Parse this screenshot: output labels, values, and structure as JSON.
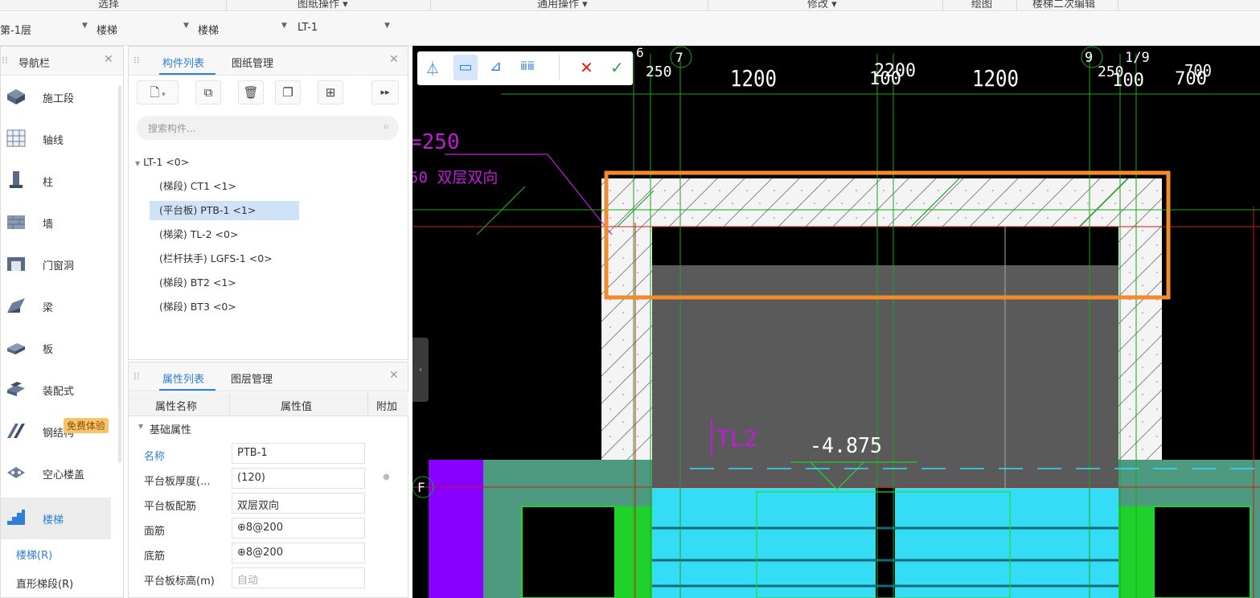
{
  "ribbon": {
    "groups": [
      "选择",
      "图纸操作 ▾",
      "通用操作 ▾",
      "修改 ▾",
      "绘图",
      "楼梯二次编辑"
    ]
  },
  "toolbar2": {
    "dropdowns": [
      "第-1层",
      "楼梯",
      "楼梯",
      "LT-1"
    ]
  },
  "nav": {
    "title": "导航栏",
    "items": [
      {
        "label": "施工段",
        "icon": "construction-segment-icon"
      },
      {
        "label": "轴线",
        "icon": "grid-axis-icon"
      },
      {
        "label": "柱",
        "icon": "column-icon"
      },
      {
        "label": "墙",
        "icon": "wall-icon"
      },
      {
        "label": "门窗洞",
        "icon": "door-window-icon"
      },
      {
        "label": "梁",
        "icon": "beam-icon"
      },
      {
        "label": "板",
        "icon": "slab-icon"
      },
      {
        "label": "装配式",
        "icon": "prefab-icon"
      },
      {
        "label": "钢结构",
        "icon": "steel-icon"
      },
      {
        "label": "空心楼盖",
        "icon": "hollow-floor-icon"
      },
      {
        "label": "楼梯",
        "icon": "stair-icon"
      }
    ],
    "badge": "免费体验",
    "sub_items": [
      "楼梯(R)",
      "直形梯段(R)"
    ]
  },
  "components": {
    "tabs": [
      "构件列表",
      "图纸管理"
    ],
    "search_placeholder": "搜索构件...",
    "tree_root": "LT-1 <0>",
    "tree_items": [
      "(梯段) CT1 <1>",
      "(平台板) PTB-1 <1>",
      "(梯梁) TL-2 <0>",
      "(栏杆扶手) LGFS-1 <0>",
      "(梯段) BT2 <1>",
      "(梯段) BT3 <0>"
    ]
  },
  "properties": {
    "tabs": [
      "属性列表",
      "图层管理"
    ],
    "headers": [
      "属性名称",
      "属性值",
      "附加"
    ],
    "group": "基础属性",
    "rows": [
      {
        "name": "名称",
        "value": "PTB-1"
      },
      {
        "name": "平台板厚度(...",
        "value": "(120)"
      },
      {
        "name": "平台板配筋",
        "value": "双层双向"
      },
      {
        "name": "面筋",
        "value": "⊕8@200"
      },
      {
        "name": "底筋",
        "value": "⊕8@200"
      },
      {
        "name": "平台板标高(m)",
        "value": "自动"
      }
    ]
  },
  "cad": {
    "dims": [
      "1200",
      "2200",
      "1200",
      "700"
    ],
    "small_dims": [
      "250",
      "250"
    ],
    "axis_labels": [
      "6",
      "7",
      "9",
      "1/9",
      "F"
    ],
    "overlap_dims": [
      "100",
      "100",
      "700"
    ],
    "left_texts": [
      "=250",
      "50 双层双向"
    ],
    "tl_label": "TL2",
    "elevation": "-4.875"
  }
}
